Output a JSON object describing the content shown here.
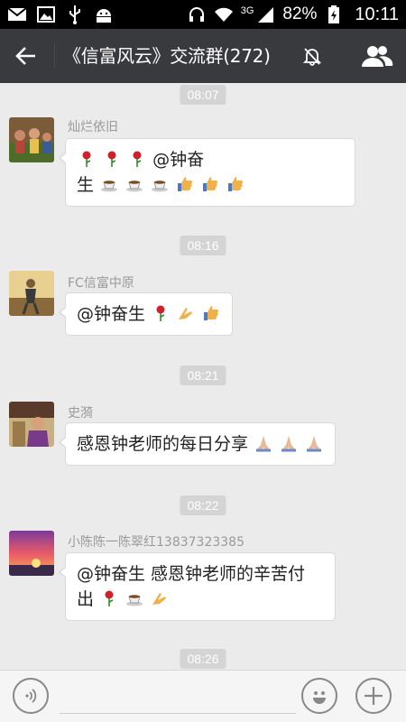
{
  "status_bar": {
    "network": "3G",
    "battery": "82%",
    "time": "10:11",
    "icons": [
      "mail-icon",
      "image-icon",
      "usb-icon",
      "android-icon",
      "headphones-icon",
      "wifi-icon",
      "signal-icon",
      "battery-icon"
    ]
  },
  "title_bar": {
    "title": "《信富风云》交流群(272)",
    "icons": [
      "back-arrow-icon",
      "mute-bell-icon",
      "group-members-icon"
    ]
  },
  "messages": [
    {
      "time": "08:07",
      "sender": "灿烂依旧",
      "line1": "@钟奋",
      "line2": "生",
      "emojis_line1": [
        "rose",
        "rose",
        "rose"
      ],
      "emojis_line2": [
        "coffee",
        "coffee",
        "coffee",
        "thumbs-up",
        "thumbs-up",
        "thumbs-up"
      ]
    },
    {
      "time": "08:16",
      "sender": "FC信富中原",
      "line1": "@钟奋生",
      "emojis_line1": [
        "rose",
        "clap",
        "thumbs-up"
      ]
    },
    {
      "time": "08:21",
      "sender": "史漪",
      "line1": "感恩钟老师的每日分享",
      "emojis_line1": [
        "pray",
        "pray",
        "pray"
      ]
    },
    {
      "time": "08:22",
      "sender": "小陈陈一陈翠红13837323385",
      "line1": "@钟奋生 感恩钟老师的辛苦付",
      "line2": "出",
      "emojis_line2": [
        "rose",
        "coffee",
        "clap"
      ]
    },
    {
      "time": "08:26"
    }
  ],
  "colors": {
    "title_bg": "#393a3e",
    "chat_bg": "#ebebeb",
    "time_pill": "#d4d4d4",
    "bubble": "#ffffff"
  }
}
